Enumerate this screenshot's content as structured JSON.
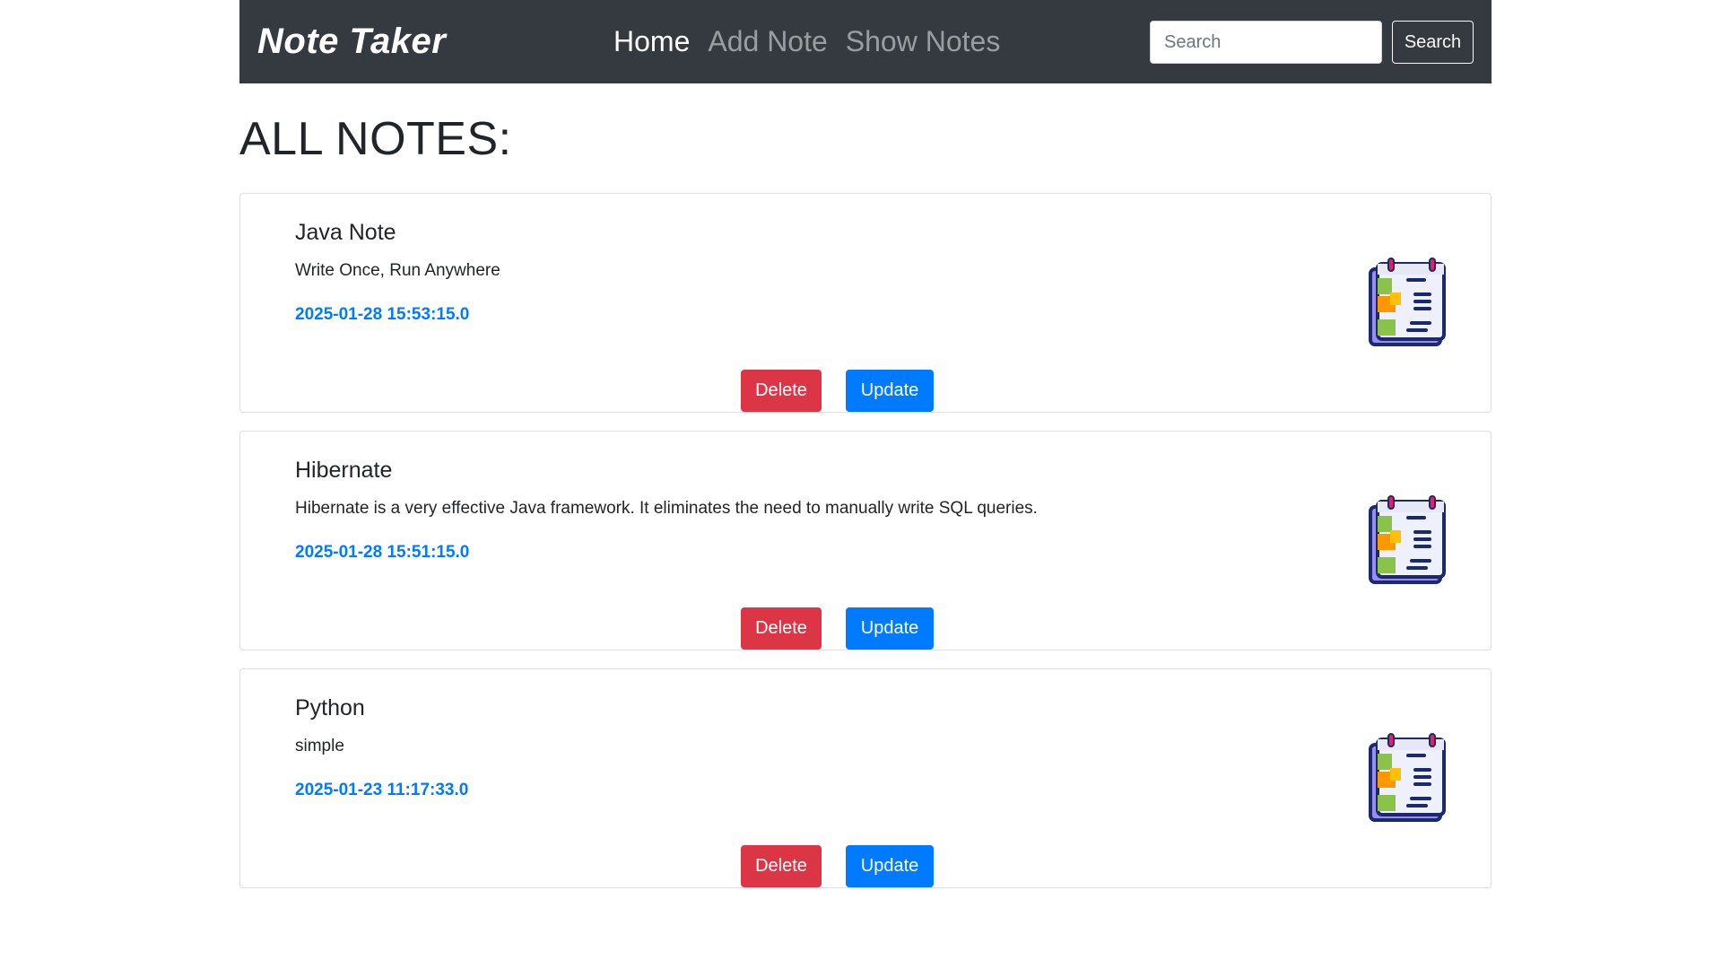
{
  "navbar": {
    "brand": "Note Taker",
    "links": [
      {
        "label": "Home",
        "active": true
      },
      {
        "label": "Add Note",
        "active": false
      },
      {
        "label": "Show Notes",
        "active": false
      }
    ],
    "search": {
      "placeholder": "Search",
      "value": "",
      "button_label": "Search"
    }
  },
  "page_title": "ALL NOTES:",
  "notes": [
    {
      "title": "Java Note",
      "content": "Write Once, Run Anywhere",
      "date": "2025-01-28 15:53:15.0",
      "delete_label": "Delete",
      "update_label": "Update"
    },
    {
      "title": "Hibernate",
      "content": "Hibernate is a very effective Java framework. It eliminates the need to manually write SQL queries.",
      "date": "2025-01-28 15:51:15.0",
      "delete_label": "Delete",
      "update_label": "Update"
    },
    {
      "title": "Python",
      "content": "simple",
      "date": "2025-01-23 11:17:33.0",
      "delete_label": "Delete",
      "update_label": "Update"
    }
  ],
  "icons": {
    "note": "notepad-checklist-icon"
  },
  "colors": {
    "navbar_bg": "#343a40",
    "date_text": "#007bff",
    "delete_button": "#dc3545",
    "update_button": "#007bff"
  }
}
